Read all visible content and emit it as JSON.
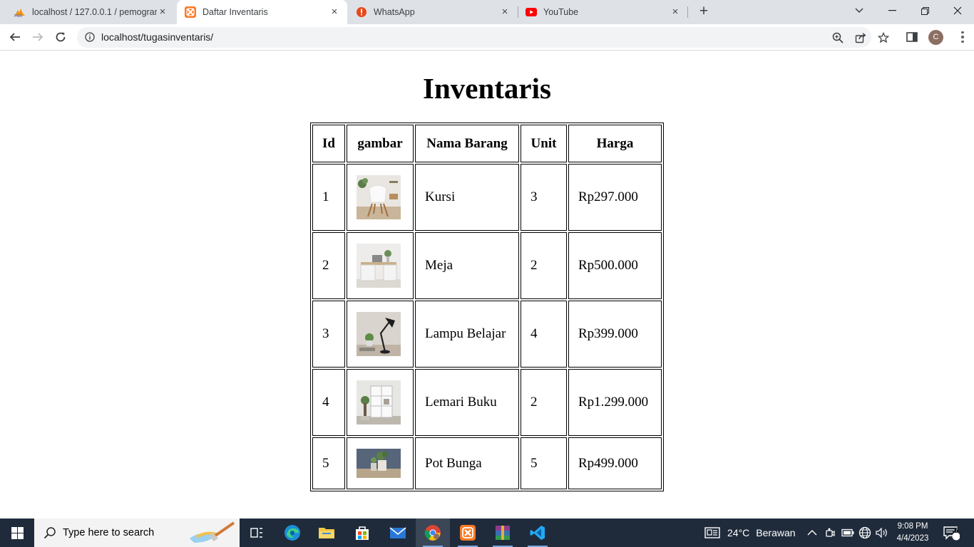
{
  "browser": {
    "tabs": [
      {
        "title": "localhost / 127.0.0.1 / pemogram",
        "icon": "phpmyadmin-icon",
        "active": false
      },
      {
        "title": "Daftar Inventaris",
        "icon": "xampp-icon",
        "active": true
      },
      {
        "title": "WhatsApp",
        "icon": "whatsapp-alert-icon",
        "active": false
      },
      {
        "title": "YouTube",
        "icon": "youtube-icon",
        "active": false
      }
    ],
    "tab_close": "×",
    "new_tab": "+",
    "url": "localhost/tugasinventaris/",
    "profile_initial": "C"
  },
  "page": {
    "heading": "Inventaris",
    "table": {
      "headers": [
        "Id",
        "gambar",
        "Nama Barang",
        "Unit",
        "Harga"
      ],
      "rows": [
        {
          "id": "1",
          "image": "chair",
          "name": "Kursi",
          "unit": "3",
          "price": "Rp297.000"
        },
        {
          "id": "2",
          "image": "desk",
          "name": "Meja",
          "unit": "2",
          "price": "Rp500.000"
        },
        {
          "id": "3",
          "image": "desk-lamp",
          "name": "Lampu Belajar",
          "unit": "4",
          "price": "Rp399.000"
        },
        {
          "id": "4",
          "image": "bookshelf",
          "name": "Lemari Buku",
          "unit": "2",
          "price": "Rp1.299.000"
        },
        {
          "id": "5",
          "image": "flower-pot",
          "name": "Pot Bunga",
          "unit": "5",
          "price": "Rp499.000"
        }
      ]
    }
  },
  "taskbar": {
    "search_placeholder": "Type here to search",
    "weather": {
      "temp": "24°C",
      "condition": "Berawan"
    },
    "time": "9:08 PM",
    "date": "4/4/2023",
    "notification_count": "5"
  },
  "colors": {
    "tabbar_bg": "#dee1e6",
    "taskbar_bg": "#1f2b3b",
    "omnibox_bg": "#f1f3f4"
  }
}
